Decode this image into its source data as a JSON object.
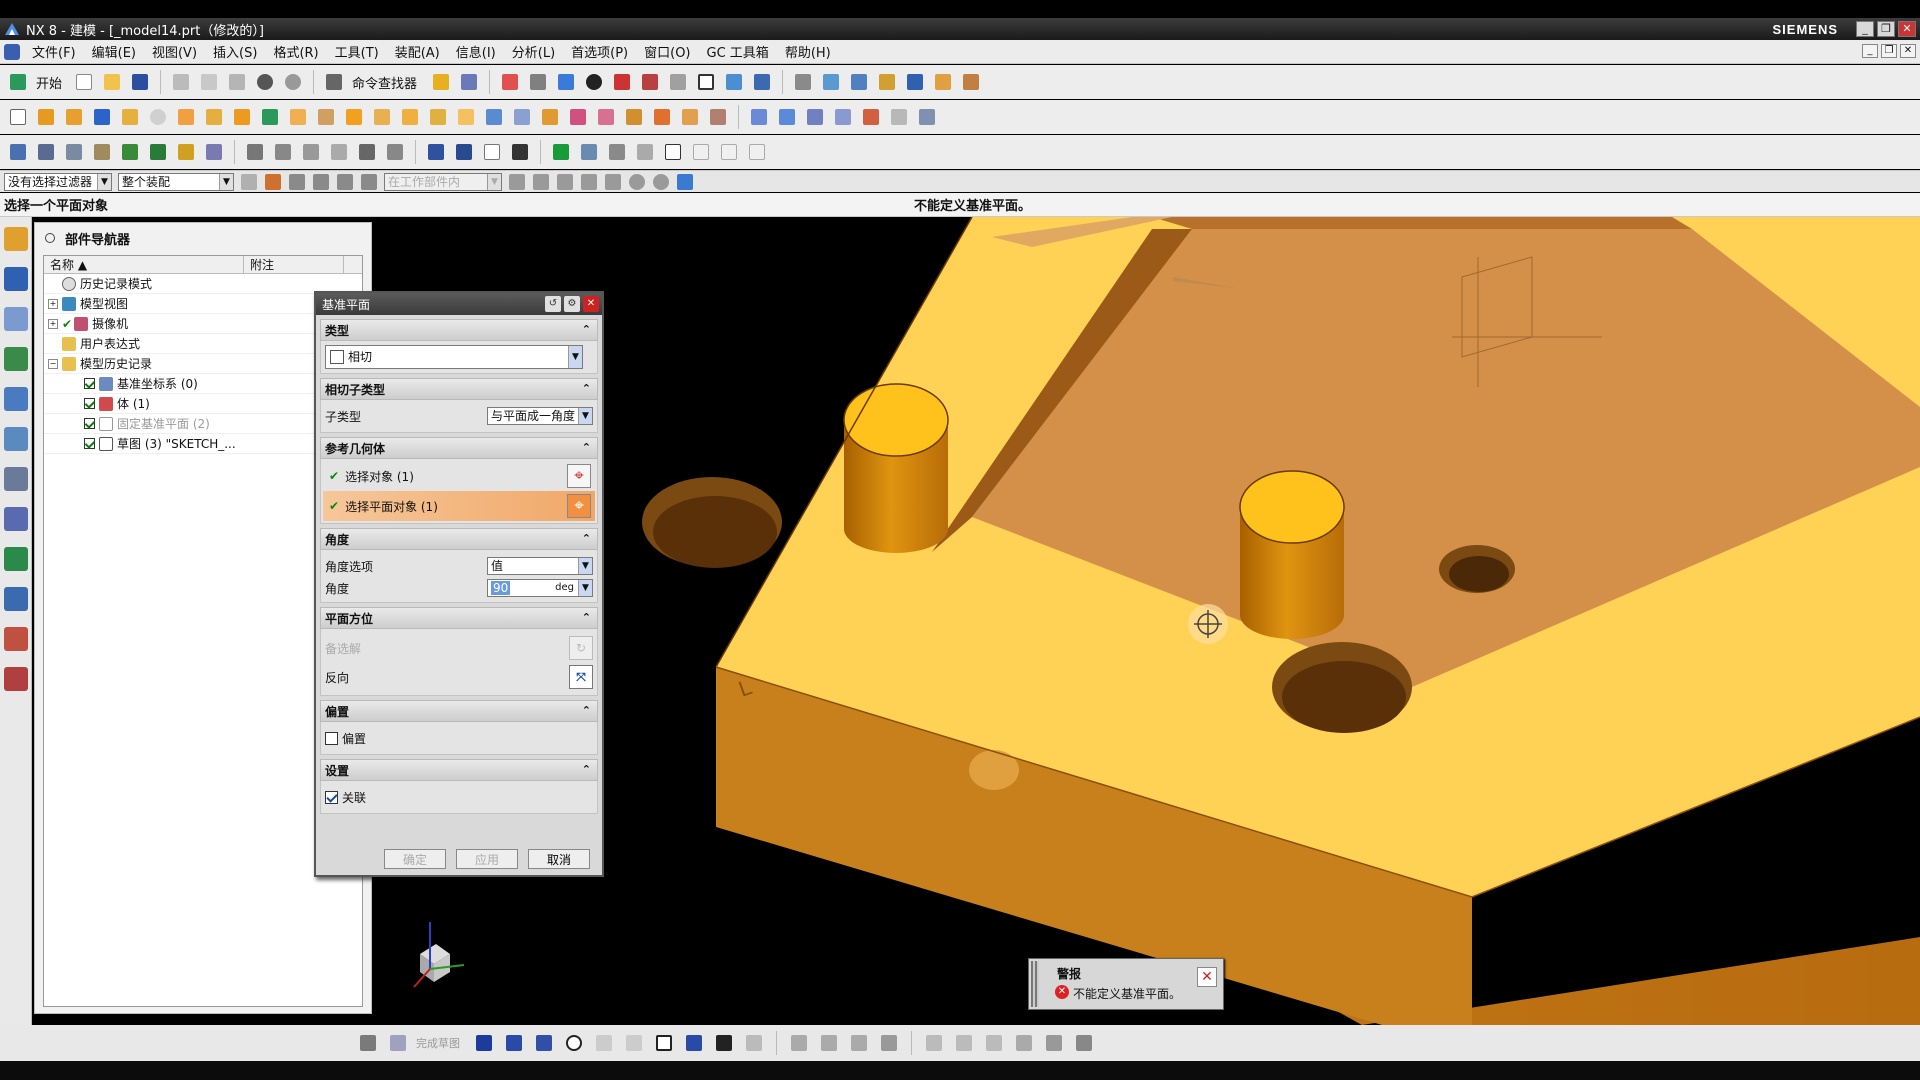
{
  "window": {
    "title": "NX 8 - 建模 - [_model14.prt（修改的）]",
    "brand": "SIEMENS"
  },
  "menu": [
    "文件(F)",
    "编辑(E)",
    "视图(V)",
    "插入(S)",
    "格式(R)",
    "工具(T)",
    "装配(A)",
    "信息(I)",
    "分析(L)",
    "首选项(P)",
    "窗口(O)",
    "GC 工具箱",
    "帮助(H)"
  ],
  "toolbar": {
    "start_label": "开始",
    "command_finder_label": "命令查找器"
  },
  "selection": {
    "filter": "没有选择过滤器",
    "scope": "整个装配",
    "snap": "在工作部件内"
  },
  "cue": {
    "left": "选择一个平面对象",
    "center": "不能定义基准平面。"
  },
  "navigator": {
    "title": "部件导航器",
    "col_name": "名称",
    "col_note": "附注",
    "items": [
      {
        "label": "历史记录模式",
        "check": false,
        "dim": false
      },
      {
        "label": "模型视图",
        "check": false,
        "dim": false
      },
      {
        "label": "摄像机",
        "check": true,
        "dim": false
      },
      {
        "label": "用户表达式",
        "check": false,
        "dim": false
      },
      {
        "label": "模型历史记录",
        "check": false,
        "dim": false
      },
      {
        "label": "基准坐标系 (0)",
        "check": true,
        "dim": false
      },
      {
        "label": "体 (1)",
        "check": true,
        "dim": false
      },
      {
        "label": "固定基准平面 (2)",
        "check": true,
        "dim": true
      },
      {
        "label": "草图 (3) \"SKETCH_...",
        "check": true,
        "dim": false
      }
    ]
  },
  "dialog": {
    "title": "基准平面",
    "type_section": "类型",
    "type_value": "相切",
    "subtype_section": "相切子类型",
    "subtype_label": "子类型",
    "subtype_value": "与平面成一角度",
    "ref_section": "参考几何体",
    "select_object": "选择对象 (1)",
    "select_plane": "选择平面对象 (1)",
    "angle_section": "角度",
    "angle_option_label": "角度选项",
    "angle_option_value": "值",
    "angle_label": "角度",
    "angle_value": "90",
    "angle_unit": "deg",
    "plane_section": "平面方位",
    "alternate_label": "备选解",
    "reverse_label": "反向",
    "offset_section": "偏置",
    "offset_label": "偏置",
    "settings_section": "设置",
    "associative_label": "关联",
    "associative_checked": true,
    "ok": "确定",
    "apply": "应用",
    "cancel": "取消"
  },
  "alert": {
    "title": "警报",
    "message": "不能定义基准平面。"
  },
  "sketchbar": {
    "finish_label": "完成草图"
  },
  "colors": {
    "part_top": "#FFD155",
    "part_side": "#D3861E",
    "cylinder_top": "#FFC21C",
    "highlight": "#F0A868"
  }
}
